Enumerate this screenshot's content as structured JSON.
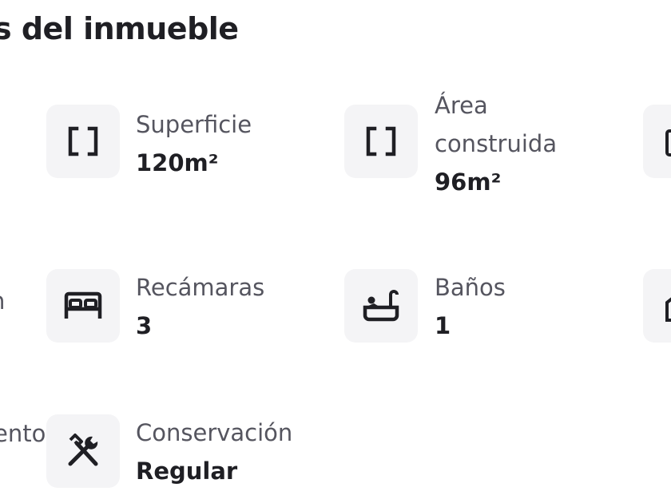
{
  "section": {
    "title": "s del inmueble"
  },
  "features": {
    "superficie": {
      "label": "Superficie",
      "value": "120m²",
      "icon": "area-brackets-icon"
    },
    "area": {
      "label_line1": "Área",
      "label_line2": "construida",
      "value": "96m²",
      "icon": "area-brackets-icon"
    },
    "recamaras": {
      "label": "Recámaras",
      "value": "3",
      "icon": "bed-icon"
    },
    "banos": {
      "label": "Baños",
      "value": "1",
      "icon": "bathtub-icon"
    },
    "conservacion": {
      "label": "Conservación",
      "value": "Regular",
      "icon": "tools-icon"
    }
  },
  "cutoff": {
    "left_row2": "n",
    "left_row3": "ento"
  },
  "colors": {
    "icon_bg": "#f4f4f6",
    "label": "#55555f",
    "value": "#1f1f24"
  }
}
